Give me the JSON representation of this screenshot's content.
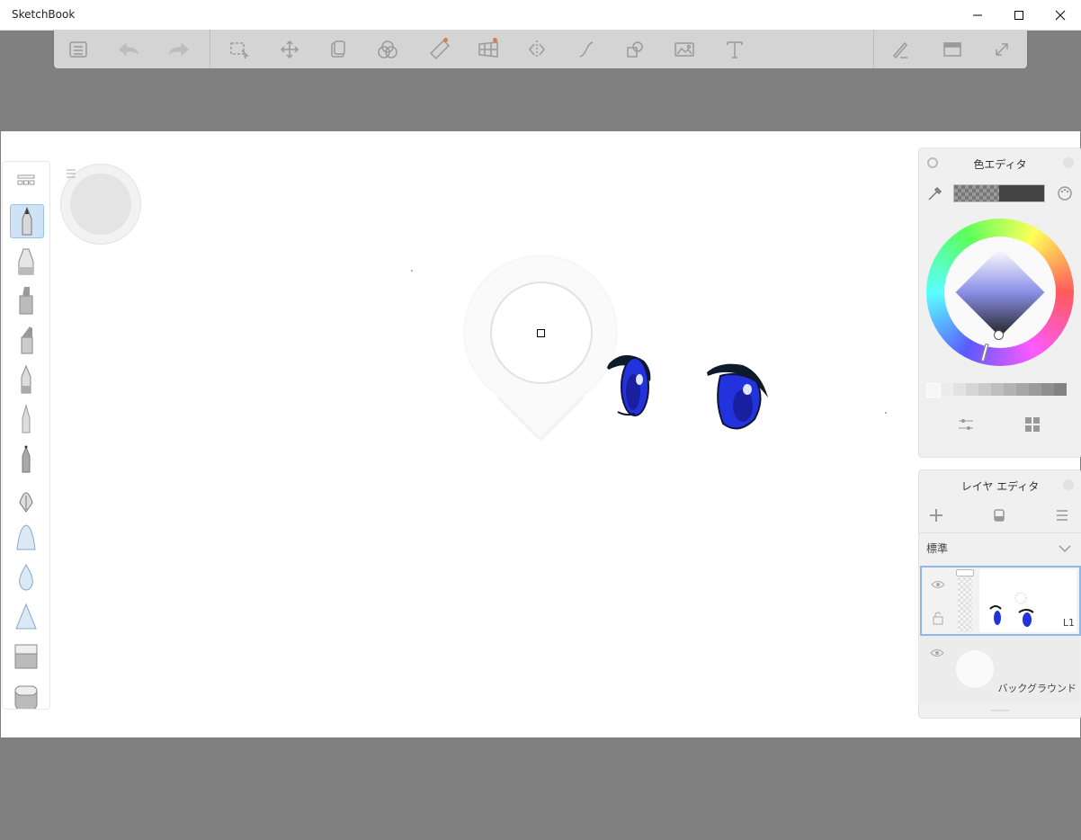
{
  "window": {
    "title": "SketchBook"
  },
  "colors": {
    "accent": "#4a90d9",
    "toolbar_bg": "#d4d4d4",
    "workspace": "#808080",
    "eye_blue": "#2233dd"
  },
  "toolbar": {
    "items": [
      "list-icon",
      "undo-icon",
      "redo-icon",
      "select-icon",
      "move-icon",
      "copy-icon",
      "color-mix-icon",
      "ruler-icon",
      "perspective-icon",
      "symmetry-icon",
      "curve-icon",
      "shapes-icon",
      "image-icon",
      "text-icon",
      "brush-settings-icon",
      "window-icon",
      "fullscreen-icon"
    ]
  },
  "color_editor": {
    "title": "色エディタ"
  },
  "layer_editor": {
    "title": "レイヤ エディタ",
    "blend_mode": "標準",
    "layers": [
      {
        "label": "L1"
      },
      {
        "label": "バックグラウンド"
      }
    ]
  }
}
